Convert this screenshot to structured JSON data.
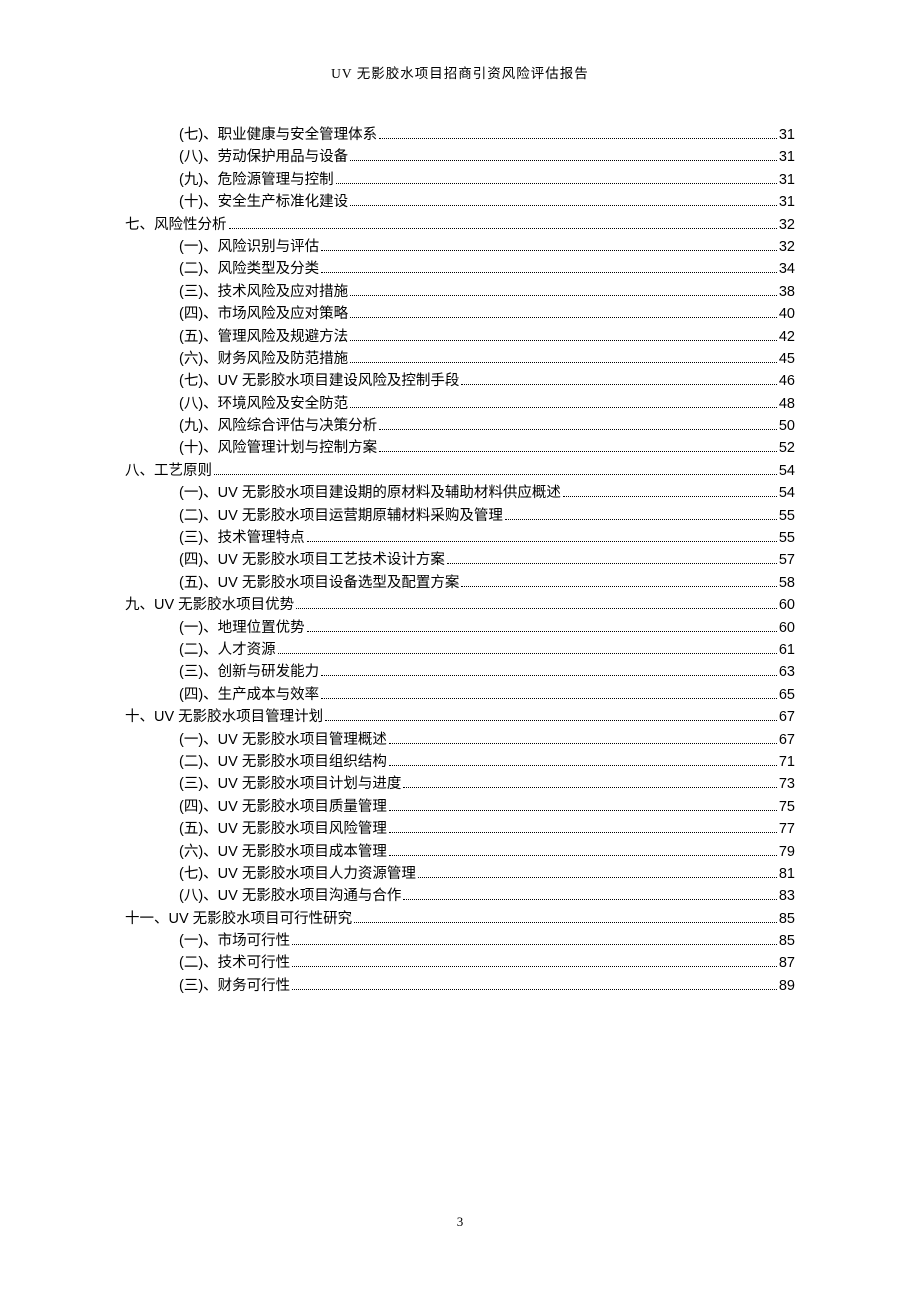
{
  "header": {
    "title": "UV 无影胶水项目招商引资风险评估报告"
  },
  "footer": {
    "page_number": "3"
  },
  "toc": [
    {
      "indent": 1,
      "label": "(七)、职业健康与安全管理体系",
      "page": "31"
    },
    {
      "indent": 1,
      "label": "(八)、劳动保护用品与设备",
      "page": "31"
    },
    {
      "indent": 1,
      "label": "(九)、危险源管理与控制",
      "page": "31"
    },
    {
      "indent": 1,
      "label": "(十)、安全生产标准化建设",
      "page": "31"
    },
    {
      "indent": 0,
      "label": "七、风险性分析",
      "page": "32"
    },
    {
      "indent": 1,
      "label": "(一)、风险识别与评估",
      "page": "32"
    },
    {
      "indent": 1,
      "label": "(二)、风险类型及分类",
      "page": "34"
    },
    {
      "indent": 1,
      "label": "(三)、技术风险及应对措施",
      "page": "38"
    },
    {
      "indent": 1,
      "label": "(四)、市场风险及应对策略",
      "page": "40"
    },
    {
      "indent": 1,
      "label": "(五)、管理风险及规避方法",
      "page": "42"
    },
    {
      "indent": 1,
      "label": "(六)、财务风险及防范措施",
      "page": "45"
    },
    {
      "indent": 1,
      "label": "(七)、UV 无影胶水项目建设风险及控制手段",
      "page": "46"
    },
    {
      "indent": 1,
      "label": "(八)、环境风险及安全防范",
      "page": "48"
    },
    {
      "indent": 1,
      "label": "(九)、风险综合评估与决策分析",
      "page": "50"
    },
    {
      "indent": 1,
      "label": "(十)、风险管理计划与控制方案",
      "page": "52"
    },
    {
      "indent": 0,
      "label": "八、工艺原则",
      "page": "54"
    },
    {
      "indent": 1,
      "label": "(一)、UV 无影胶水项目建设期的原材料及辅助材料供应概述",
      "page": "54"
    },
    {
      "indent": 1,
      "label": "(二)、UV 无影胶水项目运营期原辅材料采购及管理",
      "page": "55"
    },
    {
      "indent": 1,
      "label": "(三)、技术管理特点",
      "page": "55"
    },
    {
      "indent": 1,
      "label": "(四)、UV 无影胶水项目工艺技术设计方案",
      "page": "57"
    },
    {
      "indent": 1,
      "label": "(五)、UV 无影胶水项目设备选型及配置方案",
      "page": "58"
    },
    {
      "indent": 0,
      "label": "九、UV 无影胶水项目优势",
      "page": "60"
    },
    {
      "indent": 1,
      "label": "(一)、地理位置优势",
      "page": "60"
    },
    {
      "indent": 1,
      "label": "(二)、人才资源",
      "page": "61"
    },
    {
      "indent": 1,
      "label": "(三)、创新与研发能力",
      "page": "63"
    },
    {
      "indent": 1,
      "label": "(四)、生产成本与效率",
      "page": "65"
    },
    {
      "indent": 0,
      "label": "十、UV 无影胶水项目管理计划",
      "page": "67"
    },
    {
      "indent": 1,
      "label": "(一)、UV 无影胶水项目管理概述",
      "page": "67"
    },
    {
      "indent": 1,
      "label": "(二)、UV 无影胶水项目组织结构",
      "page": "71"
    },
    {
      "indent": 1,
      "label": "(三)、UV 无影胶水项目计划与进度",
      "page": "73"
    },
    {
      "indent": 1,
      "label": "(四)、UV 无影胶水项目质量管理",
      "page": "75"
    },
    {
      "indent": 1,
      "label": "(五)、UV 无影胶水项目风险管理",
      "page": "77"
    },
    {
      "indent": 1,
      "label": "(六)、UV 无影胶水项目成本管理",
      "page": "79"
    },
    {
      "indent": 1,
      "label": "(七)、UV 无影胶水项目人力资源管理",
      "page": "81"
    },
    {
      "indent": 1,
      "label": "(八)、UV 无影胶水项目沟通与合作",
      "page": "83"
    },
    {
      "indent": 0,
      "label": "十一、UV 无影胶水项目可行性研究",
      "page": "85"
    },
    {
      "indent": 1,
      "label": "(一)、市场可行性",
      "page": "85"
    },
    {
      "indent": 1,
      "label": "(二)、技术可行性",
      "page": "87"
    },
    {
      "indent": 1,
      "label": "(三)、财务可行性",
      "page": "89"
    }
  ]
}
